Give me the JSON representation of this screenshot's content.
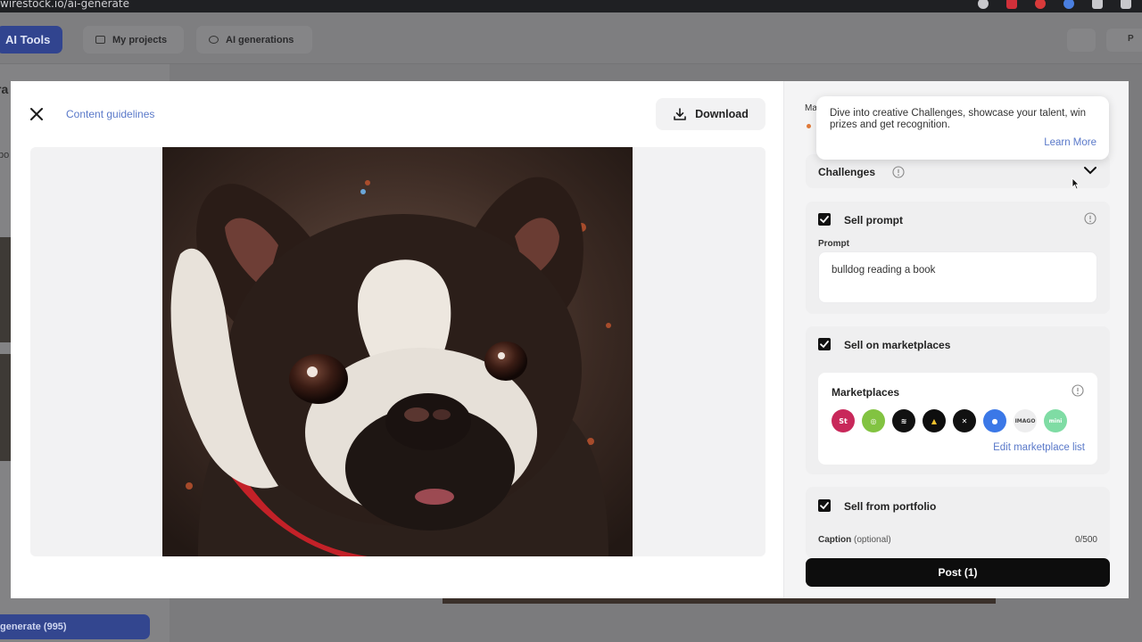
{
  "browser": {
    "url": "wirestock.io/ai-generate",
    "icon_colors": [
      "#c8c8cc",
      "#d0303a",
      "#d83a3a",
      "#4a7fe0",
      "#c8c8cc",
      "#c8c8cc"
    ]
  },
  "topnav": {
    "ai_tools": "AI Tools",
    "my_projects": "My projects",
    "ai_generations": "AI generations",
    "right_label": "P"
  },
  "sidebar": {
    "title_fragment": "ra",
    "text_fragment": "bo",
    "generate_button": "generate (995)"
  },
  "modal": {
    "content_guidelines": "Content guidelines",
    "download": "Download",
    "image_alt": "bulldog reading a book"
  },
  "right_panel": {
    "peek_label": "Ma",
    "challenges": {
      "title": "Challenges"
    },
    "sell_prompt": {
      "title": "Sell prompt",
      "checked": true,
      "prompt_label": "Prompt",
      "prompt_value": "bulldog reading a book"
    },
    "sell_on_marketplaces": {
      "title": "Sell on marketplaces",
      "checked": true,
      "marketplaces_label": "Marketplaces",
      "marketplace_icons": [
        {
          "name": "shutterstock",
          "glyph": "St",
          "bg": "#c8285a",
          "fg": "#ffffff"
        },
        {
          "name": "freepik",
          "glyph": "◎",
          "bg": "#82c341",
          "fg": "#ffffff"
        },
        {
          "name": "dreamstime",
          "glyph": "≋",
          "bg": "#111111",
          "fg": "#ffffff"
        },
        {
          "name": "123rf",
          "glyph": "▲",
          "bg": "#0e0e0e",
          "fg": "#f2c12e"
        },
        {
          "name": "x",
          "glyph": "✕",
          "bg": "#111111",
          "fg": "#ffffff"
        },
        {
          "name": "reddit",
          "glyph": "●",
          "bg": "#3b78e7",
          "fg": "#ffffff"
        },
        {
          "name": "imago",
          "glyph": "IMAGO",
          "bg": "#ededee",
          "fg": "#444444"
        },
        {
          "name": "mini",
          "glyph": "mini",
          "bg": "#7fdca4",
          "fg": "#ffffff"
        }
      ],
      "edit_link": "Edit marketplace list"
    },
    "sell_from_portfolio": {
      "title": "Sell from portfolio",
      "checked": true,
      "caption_label": "Caption",
      "caption_optional": "(optional)",
      "caption_count": "0/500"
    },
    "post_button": "Post (1)"
  },
  "tooltip": {
    "text": "Dive into creative Challenges, showcase your talent, win prizes and get recognition.",
    "link": "Learn More"
  }
}
